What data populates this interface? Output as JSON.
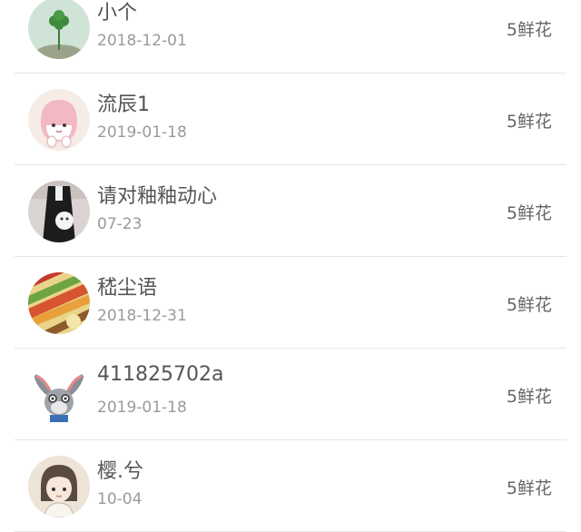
{
  "donors": [
    {
      "name": "小个",
      "date": "2018-12-01",
      "reward": "5鲜花",
      "avatar": "clover-avatar"
    },
    {
      "name": "流辰1",
      "date": "2019-01-18",
      "reward": "5鲜花",
      "avatar": "pink-peach-avatar"
    },
    {
      "name": "请对釉釉动心",
      "date": "07-23",
      "reward": "5鲜花",
      "avatar": "dress-avatar"
    },
    {
      "name": "嵇尘语",
      "date": "2018-12-31",
      "reward": "5鲜花",
      "avatar": "crayons-avatar"
    },
    {
      "name": "411825702a",
      "date": "2019-01-18",
      "reward": "5鲜花",
      "avatar": "rabbit-avatar"
    },
    {
      "name": "樱.兮",
      "date": "10-04",
      "reward": "5鲜花",
      "avatar": "girl-avatar"
    }
  ]
}
